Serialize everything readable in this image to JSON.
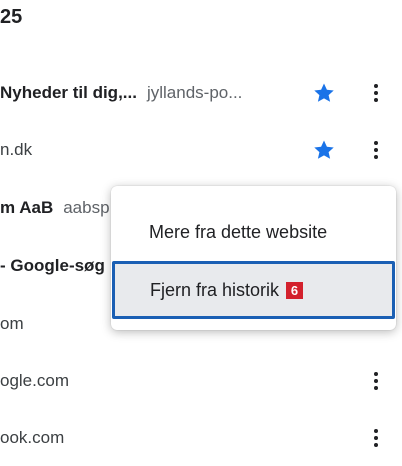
{
  "history": {
    "date_header": "25",
    "rows": [
      {
        "title": "Nyheder til dig,...",
        "domain": "jyllands-po..."
      },
      {
        "title": "n.dk"
      },
      {
        "title": "m AaB",
        "domain": "aabsp"
      },
      {
        "title": "- Google-søg"
      },
      {
        "title": "om"
      },
      {
        "title": "ogle.com"
      },
      {
        "title": "ook.com"
      }
    ]
  },
  "context_menu": {
    "items": [
      {
        "label": "Mere fra dette website"
      },
      {
        "label": "Fjern fra historik",
        "badge": "6"
      }
    ]
  },
  "colors": {
    "star": "#1a73e8",
    "focus_border": "#1a5fb4",
    "badge": "#d3212d",
    "highlight": "#e8eaed"
  }
}
